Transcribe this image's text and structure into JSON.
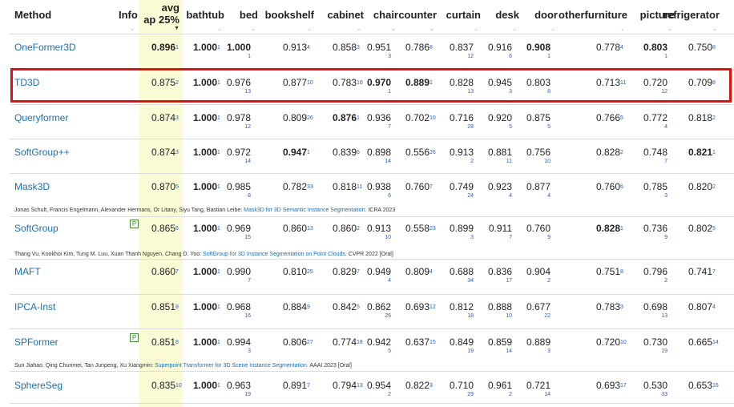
{
  "columns": [
    {
      "key": "method",
      "label": "Method"
    },
    {
      "key": "info",
      "label": "Info"
    },
    {
      "key": "avg",
      "label_line1": "avg",
      "label_line2": "ap 25%"
    },
    {
      "key": "bathtub",
      "label": "bathtub"
    },
    {
      "key": "bed",
      "label": "bed"
    },
    {
      "key": "bookshelf",
      "label": "bookshelf"
    },
    {
      "key": "cabinet",
      "label": "cabinet"
    },
    {
      "key": "chair",
      "label": "chair"
    },
    {
      "key": "counter",
      "label": "counter"
    },
    {
      "key": "curtain",
      "label": "curtain"
    },
    {
      "key": "desk",
      "label": "desk"
    },
    {
      "key": "door",
      "label": "door"
    },
    {
      "key": "otherfurniture",
      "label": "otherfurniture"
    },
    {
      "key": "picture",
      "label": "picture"
    },
    {
      "key": "refrigerator",
      "label": "refrigerator"
    }
  ],
  "sort_glyph": "⌄",
  "sort_active_glyph": "▼",
  "pub_icon_glyph": "P",
  "highlight_color": "#e01010",
  "rows": [
    {
      "name": "OneFormer3D",
      "pub": false,
      "cells": [
        [
          "0.896",
          "1",
          true
        ],
        [
          "1.000",
          "1",
          true
        ],
        [
          "1.000",
          "1",
          true
        ],
        [
          "0.913",
          "4",
          false
        ],
        [
          "0.858",
          "3",
          false
        ],
        [
          "0.951",
          "3",
          false
        ],
        [
          "0.786",
          "8",
          false
        ],
        [
          "0.837",
          "12",
          false
        ],
        [
          "0.916",
          "6",
          false
        ],
        [
          "0.908",
          "1",
          true
        ],
        [
          "0.778",
          "4",
          false
        ],
        [
          "0.803",
          "1",
          true
        ],
        [
          "0.750",
          "8",
          false
        ]
      ]
    },
    {
      "name": "TD3D",
      "pub": false,
      "highlight": true,
      "cells": [
        [
          "0.875",
          "2",
          false
        ],
        [
          "1.000",
          "1",
          true
        ],
        [
          "0.976",
          "13",
          false
        ],
        [
          "0.877",
          "10",
          false
        ],
        [
          "0.783",
          "16",
          false
        ],
        [
          "0.970",
          "1",
          true
        ],
        [
          "0.889",
          "1",
          true
        ],
        [
          "0.828",
          "13",
          false
        ],
        [
          "0.945",
          "3",
          false
        ],
        [
          "0.803",
          "8",
          false
        ],
        [
          "0.713",
          "11",
          false
        ],
        [
          "0.720",
          "12",
          false
        ],
        [
          "0.709",
          "8",
          false
        ]
      ]
    },
    {
      "name": "Queryformer",
      "pub": false,
      "cells": [
        [
          "0.874",
          "3",
          false
        ],
        [
          "1.000",
          "1",
          true
        ],
        [
          "0.978",
          "12",
          false
        ],
        [
          "0.809",
          "26",
          false
        ],
        [
          "0.876",
          "1",
          true
        ],
        [
          "0.936",
          "7",
          false
        ],
        [
          "0.702",
          "10",
          false
        ],
        [
          "0.716",
          "28",
          false
        ],
        [
          "0.920",
          "5",
          false
        ],
        [
          "0.875",
          "5",
          false
        ],
        [
          "0.766",
          "5",
          false
        ],
        [
          "0.772",
          "4",
          false
        ],
        [
          "0.818",
          "2",
          false
        ]
      ]
    },
    {
      "name": "SoftGroup++",
      "pub": false,
      "cells": [
        [
          "0.874",
          "3",
          false
        ],
        [
          "1.000",
          "1",
          true
        ],
        [
          "0.972",
          "14",
          false
        ],
        [
          "0.947",
          "1",
          true
        ],
        [
          "0.839",
          "6",
          false
        ],
        [
          "0.898",
          "14",
          false
        ],
        [
          "0.556",
          "26",
          false
        ],
        [
          "0.913",
          "2",
          false
        ],
        [
          "0.881",
          "11",
          false
        ],
        [
          "0.756",
          "10",
          false
        ],
        [
          "0.828",
          "2",
          false
        ],
        [
          "0.748",
          "7",
          false
        ],
        [
          "0.821",
          "1",
          true
        ]
      ]
    },
    {
      "name": "Mask3D",
      "pub": false,
      "cells": [
        [
          "0.870",
          "5",
          false
        ],
        [
          "1.000",
          "1",
          true
        ],
        [
          "0.985",
          "8",
          false
        ],
        [
          "0.782",
          "33",
          false
        ],
        [
          "0.818",
          "11",
          false
        ],
        [
          "0.938",
          "6",
          false
        ],
        [
          "0.760",
          "7",
          false
        ],
        [
          "0.749",
          "24",
          false
        ],
        [
          "0.923",
          "4",
          false
        ],
        [
          "0.877",
          "4",
          false
        ],
        [
          "0.760",
          "6",
          false
        ],
        [
          "0.785",
          "3",
          false
        ],
        [
          "0.820",
          "2",
          false
        ]
      ],
      "citation": {
        "authors": "Jonas Schult, Francis Engelmann, Alexander Hermans, Or Litany, Siyu Tang, Bastian Leibe: ",
        "title": "Mask3D for 3D Semantic Instance Segmentation.",
        "venue": " ICRA 2023"
      }
    },
    {
      "name": "SoftGroup",
      "pub": true,
      "cells": [
        [
          "0.865",
          "6",
          false
        ],
        [
          "1.000",
          "1",
          true
        ],
        [
          "0.969",
          "15",
          false
        ],
        [
          "0.860",
          "13",
          false
        ],
        [
          "0.860",
          "2",
          false
        ],
        [
          "0.913",
          "10",
          false
        ],
        [
          "0.558",
          "23",
          false
        ],
        [
          "0.899",
          "3",
          false
        ],
        [
          "0.911",
          "7",
          false
        ],
        [
          "0.760",
          "9",
          false
        ],
        [
          "0.828",
          "1",
          true
        ],
        [
          "0.736",
          "9",
          false
        ],
        [
          "0.802",
          "5",
          false
        ]
      ],
      "citation": {
        "authors": "Thang Vu, Kookhoi Kim, Tung M. Luu, Xuan Thanh Nguyen, Chang D. Yoo: ",
        "title": "SoftGroup for 3D Instance Segmentation on Point Clouds.",
        "venue": " CVPR 2022 [Oral]"
      }
    },
    {
      "name": "MAFT",
      "pub": false,
      "cells": [
        [
          "0.860",
          "7",
          false
        ],
        [
          "1.000",
          "1",
          true
        ],
        [
          "0.990",
          "7",
          false
        ],
        [
          "0.810",
          "25",
          false
        ],
        [
          "0.829",
          "7",
          false
        ],
        [
          "0.949",
          "4",
          false
        ],
        [
          "0.809",
          "4",
          false
        ],
        [
          "0.688",
          "34",
          false
        ],
        [
          "0.836",
          "17",
          false
        ],
        [
          "0.904",
          "2",
          false
        ],
        [
          "0.751",
          "8",
          false
        ],
        [
          "0.796",
          "2",
          false
        ],
        [
          "0.741",
          "7",
          false
        ]
      ]
    },
    {
      "name": "IPCA-Inst",
      "pub": false,
      "cells": [
        [
          "0.851",
          "8",
          false
        ],
        [
          "1.000",
          "1",
          true
        ],
        [
          "0.968",
          "16",
          false
        ],
        [
          "0.884",
          "9",
          false
        ],
        [
          "0.842",
          "5",
          false
        ],
        [
          "0.862",
          "26",
          false
        ],
        [
          "0.693",
          "12",
          false
        ],
        [
          "0.812",
          "18",
          false
        ],
        [
          "0.888",
          "10",
          false
        ],
        [
          "0.677",
          "22",
          false
        ],
        [
          "0.783",
          "3",
          false
        ],
        [
          "0.698",
          "13",
          false
        ],
        [
          "0.807",
          "4",
          false
        ]
      ]
    },
    {
      "name": "SPFormer",
      "pub": true,
      "cells": [
        [
          "0.851",
          "8",
          false
        ],
        [
          "1.000",
          "1",
          true
        ],
        [
          "0.994",
          "3",
          false
        ],
        [
          "0.806",
          "27",
          false
        ],
        [
          "0.774",
          "18",
          false
        ],
        [
          "0.942",
          "5",
          false
        ],
        [
          "0.637",
          "15",
          false
        ],
        [
          "0.849",
          "19",
          false
        ],
        [
          "0.859",
          "14",
          false
        ],
        [
          "0.889",
          "3",
          false
        ],
        [
          "0.720",
          "10",
          false
        ],
        [
          "0.730",
          "19",
          false
        ],
        [
          "0.665",
          "14",
          false
        ]
      ],
      "citation": {
        "authors": "Sun Jiahao, Qing Chunmei, Tan Junpeng, Xu Xiangmin: ",
        "title": "Superpoint Transformer for 3D Scene Instance Segmentation.",
        "venue": " AAAI 2023 [Oral]"
      }
    },
    {
      "name": "SphereSeg",
      "pub": false,
      "cells": [
        [
          "0.835",
          "10",
          false
        ],
        [
          "1.000",
          "1",
          true
        ],
        [
          "0.963",
          "19",
          false
        ],
        [
          "0.891",
          "7",
          false
        ],
        [
          "0.794",
          "13",
          false
        ],
        [
          "0.954",
          "2",
          false
        ],
        [
          "0.822",
          "3",
          false
        ],
        [
          "0.710",
          "29",
          false
        ],
        [
          "0.961",
          "2",
          false
        ],
        [
          "0.721",
          "14",
          false
        ],
        [
          "0.693",
          "17",
          false
        ],
        [
          "0.530",
          "33",
          false
        ],
        [
          "0.653",
          "16",
          false
        ]
      ]
    }
  ]
}
